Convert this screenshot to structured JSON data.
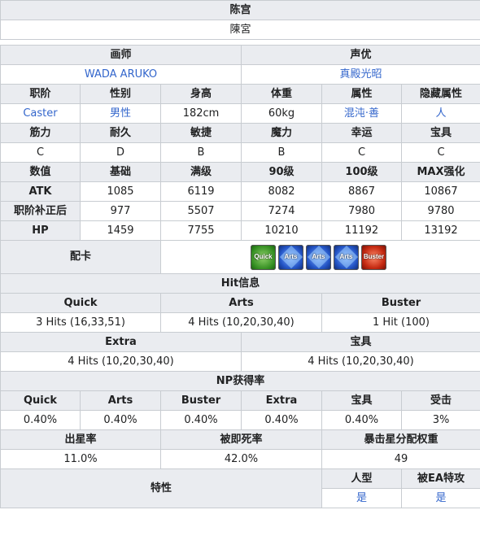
{
  "title": "陈宫",
  "title_jp": "陳宮",
  "illustrator": {
    "header": "画师",
    "value": "WADA ARUKO"
  },
  "voice_actor": {
    "header": "声优",
    "value": "真殿光昭"
  },
  "profile": {
    "headers": [
      "职阶",
      "性别",
      "身高",
      "体重",
      "属性",
      "隐藏属性"
    ],
    "values": [
      "Caster",
      "男性",
      "182cm",
      "60kg",
      "混沌·善",
      "人"
    ]
  },
  "params": {
    "headers": [
      "筋力",
      "耐久",
      "敏捷",
      "魔力",
      "幸运",
      "宝具"
    ],
    "values": [
      "C",
      "D",
      "B",
      "B",
      "C",
      "C"
    ]
  },
  "stats": {
    "headers": [
      "数值",
      "基础",
      "满级",
      "90级",
      "100级",
      "MAX强化"
    ],
    "rows": [
      {
        "label": "ATK",
        "values": [
          "1085",
          "6119",
          "8082",
          "8867",
          "10867"
        ]
      },
      {
        "label": "职阶补正后",
        "values": [
          "977",
          "5507",
          "7274",
          "7980",
          "9780"
        ]
      },
      {
        "label": "HP",
        "values": [
          "1459",
          "7755",
          "10210",
          "11192",
          "13192"
        ]
      }
    ]
  },
  "cards": {
    "header": "配卡",
    "items": [
      {
        "type": "quick",
        "label": "Quick"
      },
      {
        "type": "arts",
        "label": "Arts"
      },
      {
        "type": "arts",
        "label": "Arts"
      },
      {
        "type": "arts",
        "label": "Arts"
      },
      {
        "type": "buster",
        "label": "Buster"
      }
    ]
  },
  "hits": {
    "header": "Hit信息",
    "headers1": [
      "Quick",
      "Arts",
      "Buster"
    ],
    "values1": [
      "3 Hits (16,33,51)",
      "4 Hits (10,20,30,40)",
      "1 Hit (100)"
    ],
    "headers2": [
      "Extra",
      "宝具"
    ],
    "values2": [
      "4 Hits (10,20,30,40)",
      "4 Hits (10,20,30,40)"
    ]
  },
  "np": {
    "header": "NP获得率",
    "headers": [
      "Quick",
      "Arts",
      "Buster",
      "Extra",
      "宝具",
      "受击"
    ],
    "values": [
      "0.40%",
      "0.40%",
      "0.40%",
      "0.40%",
      "0.40%",
      "3%"
    ]
  },
  "stars": {
    "headers": [
      "出星率",
      "被即死率",
      "暴击星分配权重"
    ],
    "values": [
      "11.0%",
      "42.0%",
      "49"
    ]
  },
  "traits": {
    "header": "特性",
    "headers": [
      "人型",
      "被EA特攻"
    ],
    "values": [
      "是",
      "是"
    ]
  }
}
